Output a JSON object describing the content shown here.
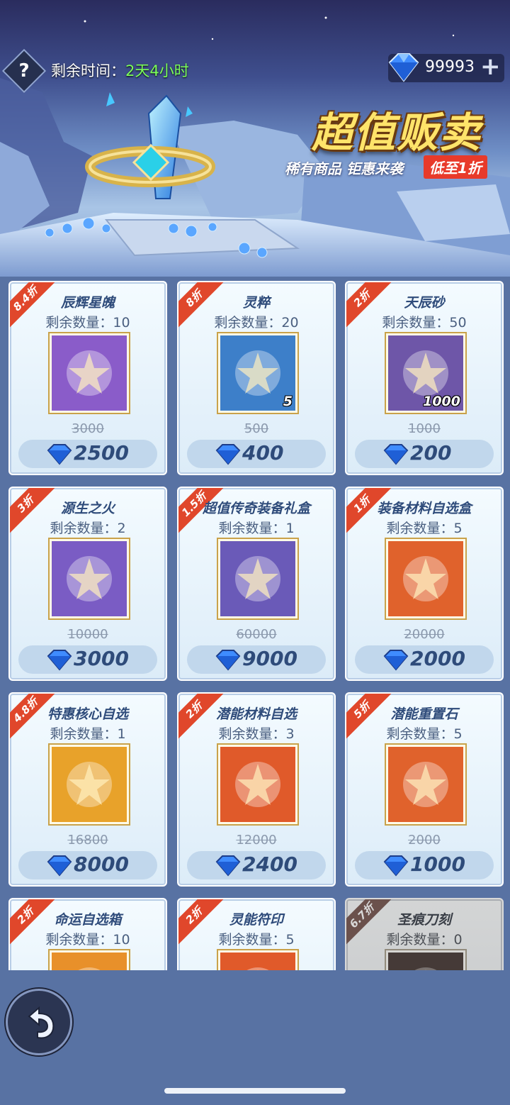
{
  "header": {
    "help_label": "?",
    "time_label": "剩余时间：",
    "time_value": "2天4小时",
    "gems": "99993",
    "gems_plus": "+"
  },
  "banner": {
    "title": "超值贩卖",
    "subtitle": "稀有商品 钜惠来袭",
    "discount": "低至1折"
  },
  "items": [
    {
      "discount": "8.4折",
      "name": "辰辉星魄",
      "remaining": "剩余数量：10",
      "qty": "",
      "old_price": "3000",
      "price": "2500",
      "icon": "star-orb-icon",
      "bg": "#8a5cc9"
    },
    {
      "discount": "8折",
      "name": "灵粹",
      "remaining": "剩余数量：20",
      "qty": "5",
      "old_price": "500",
      "price": "400",
      "icon": "spirit-swirl-icon",
      "bg": "#3d7fc9"
    },
    {
      "discount": "2折",
      "name": "天辰砂",
      "remaining": "剩余数量：50",
      "qty": "1000",
      "old_price": "1000",
      "price": "200",
      "icon": "red-sand-icon",
      "bg": "#6e56a8"
    },
    {
      "discount": "3折",
      "name": "源生之火",
      "remaining": "剩余数量：2",
      "qty": "",
      "old_price": "10000",
      "price": "3000",
      "icon": "origin-fire-icon",
      "bg": "#7a5cc4"
    },
    {
      "discount": "1.5折",
      "name": "超值传奇装备礼盒",
      "remaining": "剩余数量：1",
      "qty": "",
      "old_price": "60000",
      "price": "9000",
      "icon": "armor-box-icon",
      "bg": "#6a5ab8"
    },
    {
      "discount": "1折",
      "name": "装备材料自选盒",
      "remaining": "剩余数量：5",
      "qty": "",
      "old_price": "20000",
      "price": "2000",
      "icon": "armor-material-icon",
      "bg": "#e0622c"
    },
    {
      "discount": "4.8折",
      "name": "特惠核心自选",
      "remaining": "剩余数量：1",
      "qty": "",
      "old_price": "16800",
      "price": "8000",
      "icon": "core-card-icon",
      "bg": "#e8a22a"
    },
    {
      "discount": "2折",
      "name": "潜能材料自选",
      "remaining": "剩余数量：3",
      "qty": "",
      "old_price": "12000",
      "price": "2400",
      "icon": "treasure-chest-icon",
      "bg": "#e05a2a"
    },
    {
      "discount": "5折",
      "name": "潜能重置石",
      "remaining": "剩余数量：5",
      "qty": "",
      "old_price": "2000",
      "price": "1000",
      "icon": "reset-stone-icon",
      "bg": "#e0622c"
    },
    {
      "discount": "2折",
      "name": "命运自选箱",
      "remaining": "剩余数量：10",
      "qty": "",
      "old_price": "",
      "price": "",
      "icon": "fate-box-icon",
      "bg": "#e8902a"
    },
    {
      "discount": "2折",
      "name": "灵能符印",
      "remaining": "剩余数量：5",
      "qty": "",
      "old_price": "",
      "price": "",
      "icon": "psionic-seal-icon",
      "bg": "#e05a2a"
    },
    {
      "discount": "6.7折",
      "name": "圣痕刀刻",
      "remaining": "剩余数量：0",
      "qty": "",
      "old_price": "",
      "price": "",
      "icon": "stigma-carve-icon",
      "bg": "#7a3a2a"
    }
  ]
}
